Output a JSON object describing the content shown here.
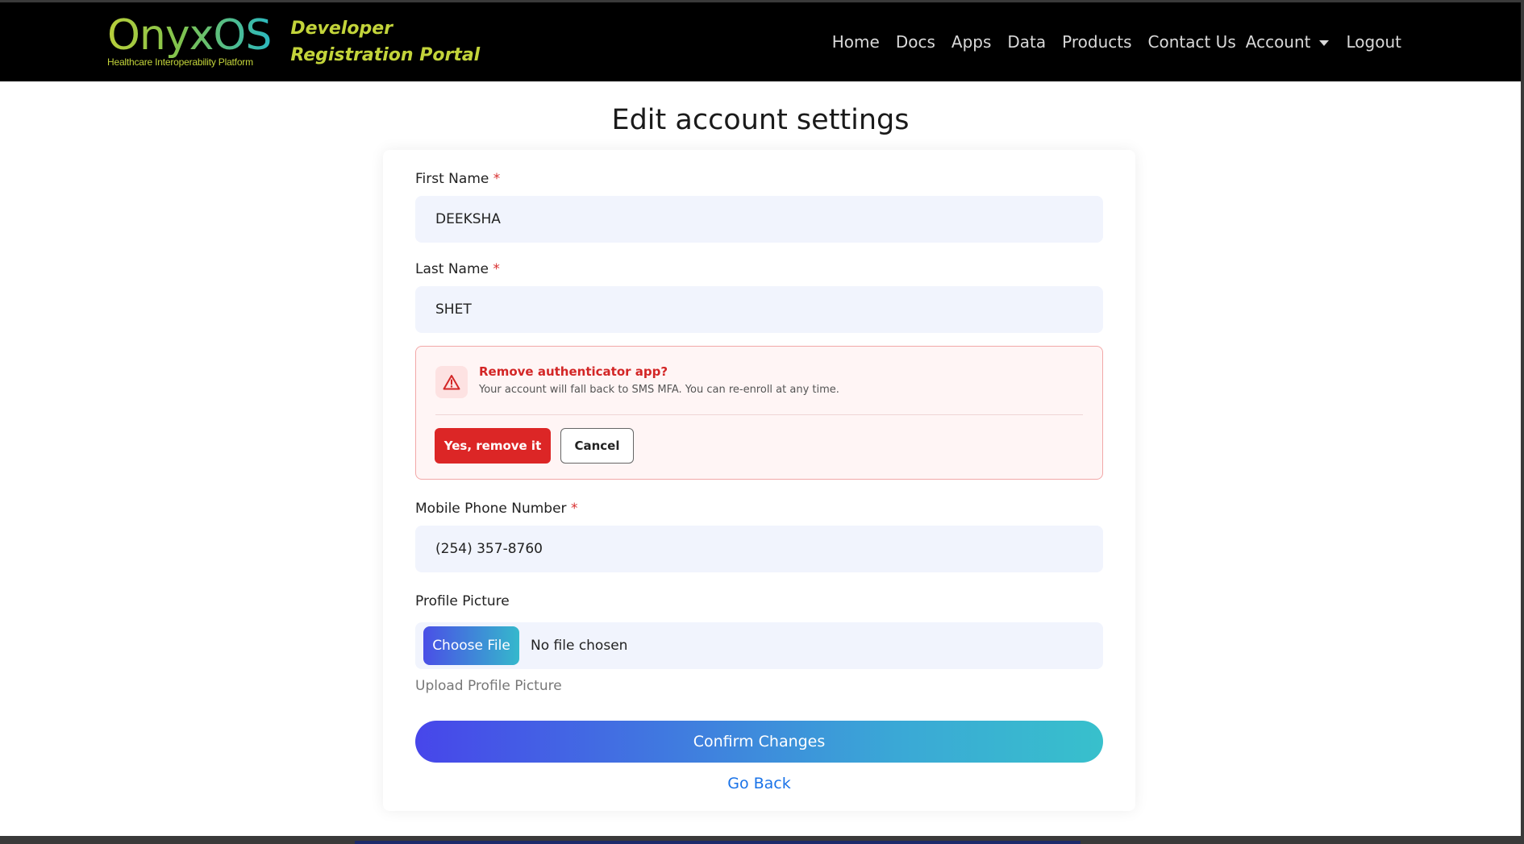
{
  "header": {
    "brand_name": "OnyxOS",
    "brand_tagline": "Healthcare Interoperability Platform",
    "portal_title": "Developer Registration Portal",
    "nav": {
      "home": "Home",
      "docs": "Docs",
      "apps": "Apps",
      "data": "Data",
      "products": "Products",
      "contact": "Contact Us",
      "account": "Account",
      "logout": "Logout"
    }
  },
  "page": {
    "title": "Edit account settings"
  },
  "form": {
    "first_name": {
      "label": "First Name",
      "required_mark": "*",
      "value": "DEEKSHA"
    },
    "last_name": {
      "label": "Last Name",
      "required_mark": "*",
      "value": "SHET"
    },
    "alert": {
      "icon": "warning-triangle-icon",
      "title": "Remove authenticator app?",
      "message": "Your account will fall back to SMS MFA. You can re-enroll at any time.",
      "confirm_label": "Yes, remove it",
      "cancel_label": "Cancel"
    },
    "phone": {
      "label": "Mobile Phone Number",
      "required_mark": "*",
      "value": "(254) 357-8760"
    },
    "profile_picture": {
      "label": "Profile Picture",
      "choose_label": "Choose File",
      "status": "No file chosen",
      "help": "Upload Profile Picture"
    },
    "confirm_label": "Confirm Changes",
    "back_label": "Go Back"
  },
  "colors": {
    "danger": "#dc2626",
    "link": "#1a73e8",
    "brand_yellow": "#c3d43a",
    "gradient_start": "#4746ea",
    "gradient_end": "#38c0cc"
  }
}
